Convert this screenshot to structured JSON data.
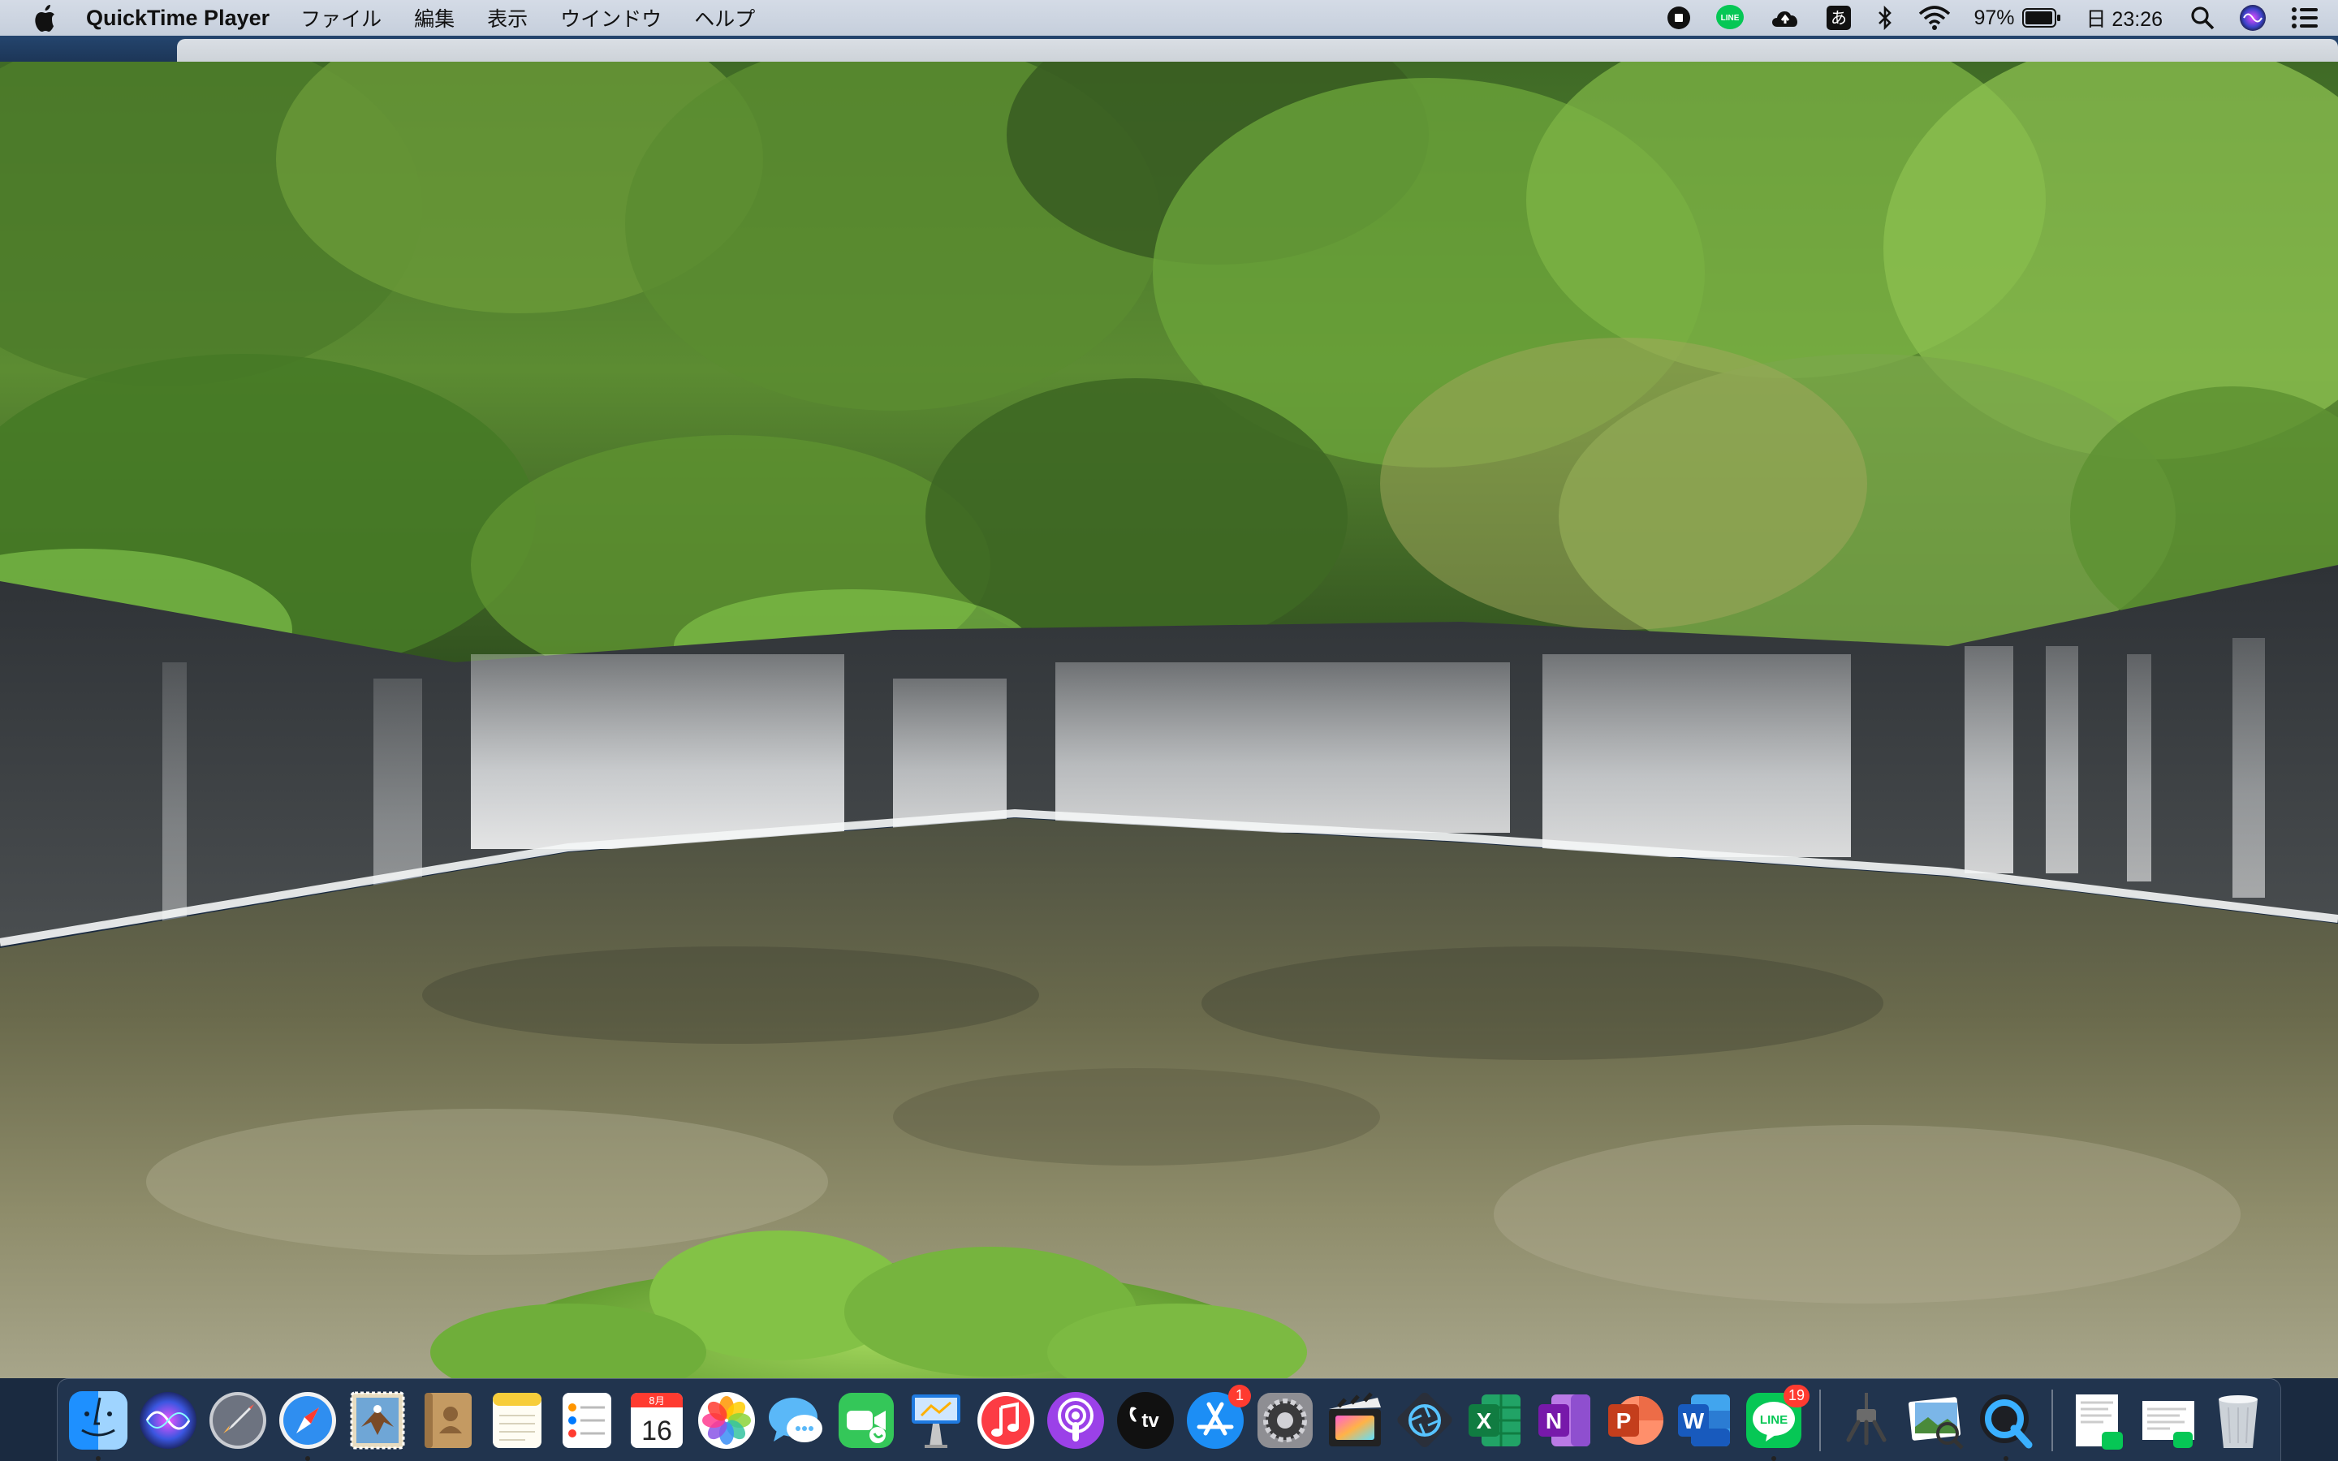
{
  "menubar": {
    "app_name": "QuickTime Player",
    "menus": [
      "ファイル",
      "編集",
      "表示",
      "ウインドウ",
      "ヘルプ"
    ],
    "status": {
      "ime_label": "あ",
      "battery_percent": "97%",
      "battery_level": 0.97,
      "clock": "日 23:26"
    }
  },
  "dock": {
    "calendar_month": "8月",
    "calendar_day": "16",
    "appletv_label": "tv",
    "appstore_badge": "1",
    "line_label": "LINE",
    "line_badge": "19",
    "excel_letter": "X",
    "onenote_letter": "N",
    "powerpoint_letter": "P",
    "word_letter": "W"
  },
  "colors": {
    "menubar": "#cdd5e1",
    "forest": "#4e7a2a",
    "rock": "#3a3e42",
    "water": "#6f6f4e",
    "dock": "#2c4466"
  }
}
